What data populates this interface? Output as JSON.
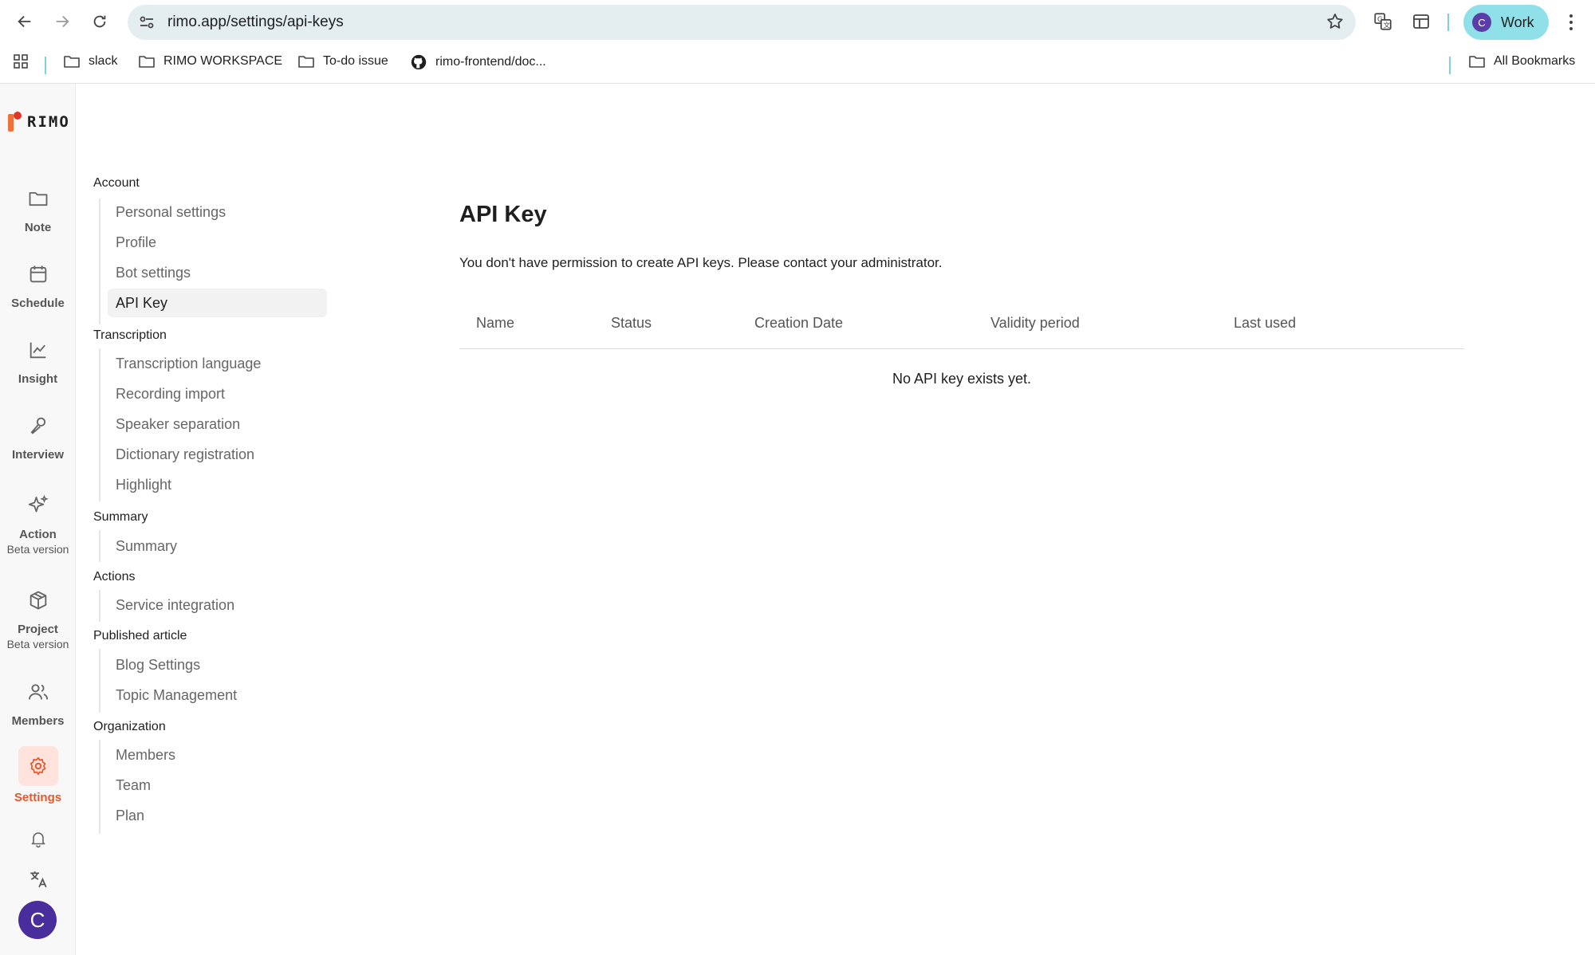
{
  "browser": {
    "url": "rimo.app/settings/api-keys",
    "profile": {
      "initial": "C",
      "name": "Work"
    },
    "bookmarks": [
      {
        "label": "slack",
        "icon": "folder-icon"
      },
      {
        "label": "RIMO WORKSPACE",
        "icon": "folder-icon"
      },
      {
        "label": "To-do issue",
        "icon": "folder-icon"
      },
      {
        "label": "rimo-frontend/doc...",
        "icon": "github-icon"
      }
    ],
    "all_bookmarks": "All Bookmarks"
  },
  "app": {
    "logo_text": "RIMO",
    "accent": "#e8562a",
    "rail": [
      {
        "label": "Note",
        "icon": "folder-icon"
      },
      {
        "label": "Schedule",
        "icon": "calendar-icon"
      },
      {
        "label": "Insight",
        "icon": "chart-icon"
      },
      {
        "label": "Interview",
        "icon": "microphone-icon"
      },
      {
        "label": "Action",
        "sub": "Beta version",
        "icon": "sparkle-icon"
      },
      {
        "label": "Project",
        "sub": "Beta version",
        "icon": "package-icon"
      },
      {
        "label": "Members",
        "icon": "users-icon"
      },
      {
        "label": "Settings",
        "icon": "gear-icon",
        "active": true
      }
    ],
    "user_initial": "C"
  },
  "settings_nav": {
    "groups": [
      {
        "title": "Account",
        "items": [
          "Personal settings",
          "Profile",
          "Bot settings",
          "API Key"
        ]
      },
      {
        "title": "Transcription",
        "items": [
          "Transcription language",
          "Recording import",
          "Speaker separation",
          "Dictionary registration",
          "Highlight"
        ]
      },
      {
        "title": "Summary",
        "items": [
          "Summary"
        ]
      },
      {
        "title": "Actions",
        "items": [
          "Service integration"
        ]
      },
      {
        "title": "Published article",
        "items": [
          "Blog Settings",
          "Topic Management"
        ]
      },
      {
        "title": "Organization",
        "items": [
          "Members",
          "Team",
          "Plan"
        ]
      }
    ],
    "active": "API Key"
  },
  "main": {
    "title": "API Key",
    "notice": "You don't have permission to create API keys. Please contact your administrator.",
    "columns": [
      "Name",
      "Status",
      "Creation Date",
      "Validity period",
      "Last used"
    ],
    "empty_message": "No API key exists yet."
  }
}
